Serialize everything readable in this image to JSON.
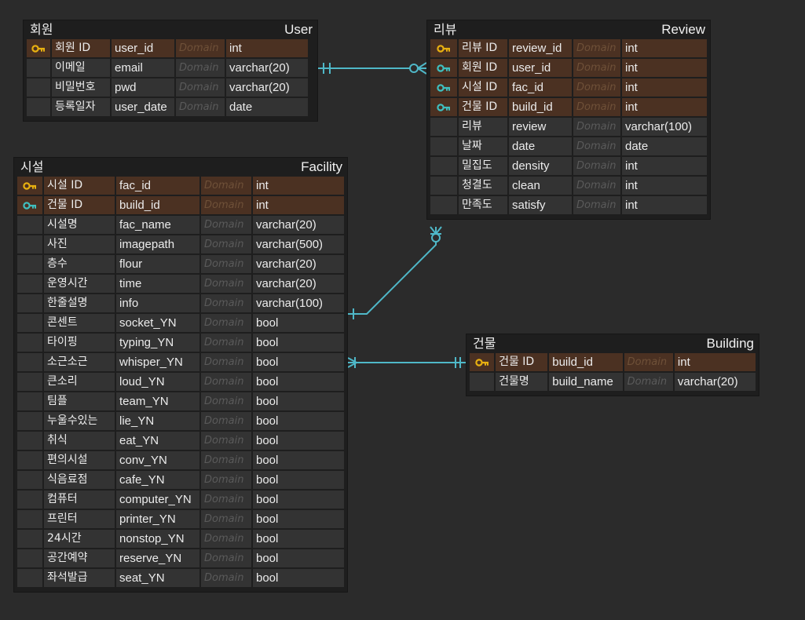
{
  "colors": {
    "background": "#2b2b2b",
    "entity_bg": "#1e1e1e",
    "key_row_bg": "#4b3122",
    "plain_row_bg": "#333333",
    "primary_key_icon": "#e8b010",
    "foreign_key_icon": "#3fbfbf",
    "relation_line": "#4fb8c8"
  },
  "domain_placeholder": "Domain",
  "entities": {
    "user": {
      "logical": "회원",
      "physical": "User",
      "columns": [
        {
          "logical": "회원 ID",
          "physical": "user_id",
          "type": "int",
          "key": "primary-key-icon"
        },
        {
          "logical": "이메일",
          "physical": "email",
          "type": "varchar(20)",
          "key": ""
        },
        {
          "logical": "비밀번호",
          "physical": "pwd",
          "type": "varchar(20)",
          "key": ""
        },
        {
          "logical": "등록일자",
          "physical": "user_date",
          "type": "date",
          "key": ""
        }
      ]
    },
    "review": {
      "logical": "리뷰",
      "physical": "Review",
      "columns": [
        {
          "logical": "리뷰 ID",
          "physical": "review_id",
          "type": "int",
          "key": "primary-key-icon"
        },
        {
          "logical": "회원 ID",
          "physical": "user_id",
          "type": "int",
          "key": "foreign-key-icon"
        },
        {
          "logical": "시설 ID",
          "physical": "fac_id",
          "type": "int",
          "key": "foreign-key-icon"
        },
        {
          "logical": "건물 ID",
          "physical": "build_id",
          "type": "int",
          "key": "foreign-key-icon"
        },
        {
          "logical": "리뷰",
          "physical": "review",
          "type": "varchar(100)",
          "key": ""
        },
        {
          "logical": "날짜",
          "physical": "date",
          "type": "date",
          "key": ""
        },
        {
          "logical": "밀집도",
          "physical": "density",
          "type": "int",
          "key": ""
        },
        {
          "logical": "청결도",
          "physical": "clean",
          "type": "int",
          "key": ""
        },
        {
          "logical": "만족도",
          "physical": "satisfy",
          "type": "int",
          "key": ""
        }
      ]
    },
    "facility": {
      "logical": "시설",
      "physical": "Facility",
      "columns": [
        {
          "logical": "시설 ID",
          "physical": "fac_id",
          "type": "int",
          "key": "primary-key-icon"
        },
        {
          "logical": "건물 ID",
          "physical": "build_id",
          "type": "int",
          "key": "foreign-key-icon"
        },
        {
          "logical": "시설명",
          "physical": "fac_name",
          "type": "varchar(20)",
          "key": ""
        },
        {
          "logical": "사진",
          "physical": "imagepath",
          "type": "varchar(500)",
          "key": ""
        },
        {
          "logical": "층수",
          "physical": "flour",
          "type": "varchar(20)",
          "key": ""
        },
        {
          "logical": "운영시간",
          "physical": "time",
          "type": "varchar(20)",
          "key": ""
        },
        {
          "logical": "한줄설명",
          "physical": "info",
          "type": "varchar(100)",
          "key": ""
        },
        {
          "logical": "콘센트",
          "physical": "socket_YN",
          "type": "bool",
          "key": ""
        },
        {
          "logical": "타이핑",
          "physical": "typing_YN",
          "type": "bool",
          "key": ""
        },
        {
          "logical": "소근소근",
          "physical": "whisper_YN",
          "type": "bool",
          "key": ""
        },
        {
          "logical": "큰소리",
          "physical": "loud_YN",
          "type": "bool",
          "key": ""
        },
        {
          "logical": "팀플",
          "physical": "team_YN",
          "type": "bool",
          "key": ""
        },
        {
          "logical": "누울수있는",
          "physical": "lie_YN",
          "type": "bool",
          "key": ""
        },
        {
          "logical": "취식",
          "physical": "eat_YN",
          "type": "bool",
          "key": ""
        },
        {
          "logical": "편의시설",
          "physical": "conv_YN",
          "type": "bool",
          "key": ""
        },
        {
          "logical": "식음료점",
          "physical": "cafe_YN",
          "type": "bool",
          "key": ""
        },
        {
          "logical": "컴퓨터",
          "physical": "computer_YN",
          "type": "bool",
          "key": ""
        },
        {
          "logical": "프린터",
          "physical": "printer_YN",
          "type": "bool",
          "key": ""
        },
        {
          "logical": "24시간",
          "physical": "nonstop_YN",
          "type": "bool",
          "key": ""
        },
        {
          "logical": "공간예약",
          "physical": "reserve_YN",
          "type": "bool",
          "key": ""
        },
        {
          "logical": "좌석발급",
          "physical": "seat_YN",
          "type": "bool",
          "key": ""
        }
      ]
    },
    "building": {
      "logical": "건물",
      "physical": "Building",
      "columns": [
        {
          "logical": "건물 ID",
          "physical": "build_id",
          "type": "int",
          "key": "primary-key-icon"
        },
        {
          "logical": "건물명",
          "physical": "build_name",
          "type": "varchar(20)",
          "key": ""
        }
      ]
    }
  }
}
